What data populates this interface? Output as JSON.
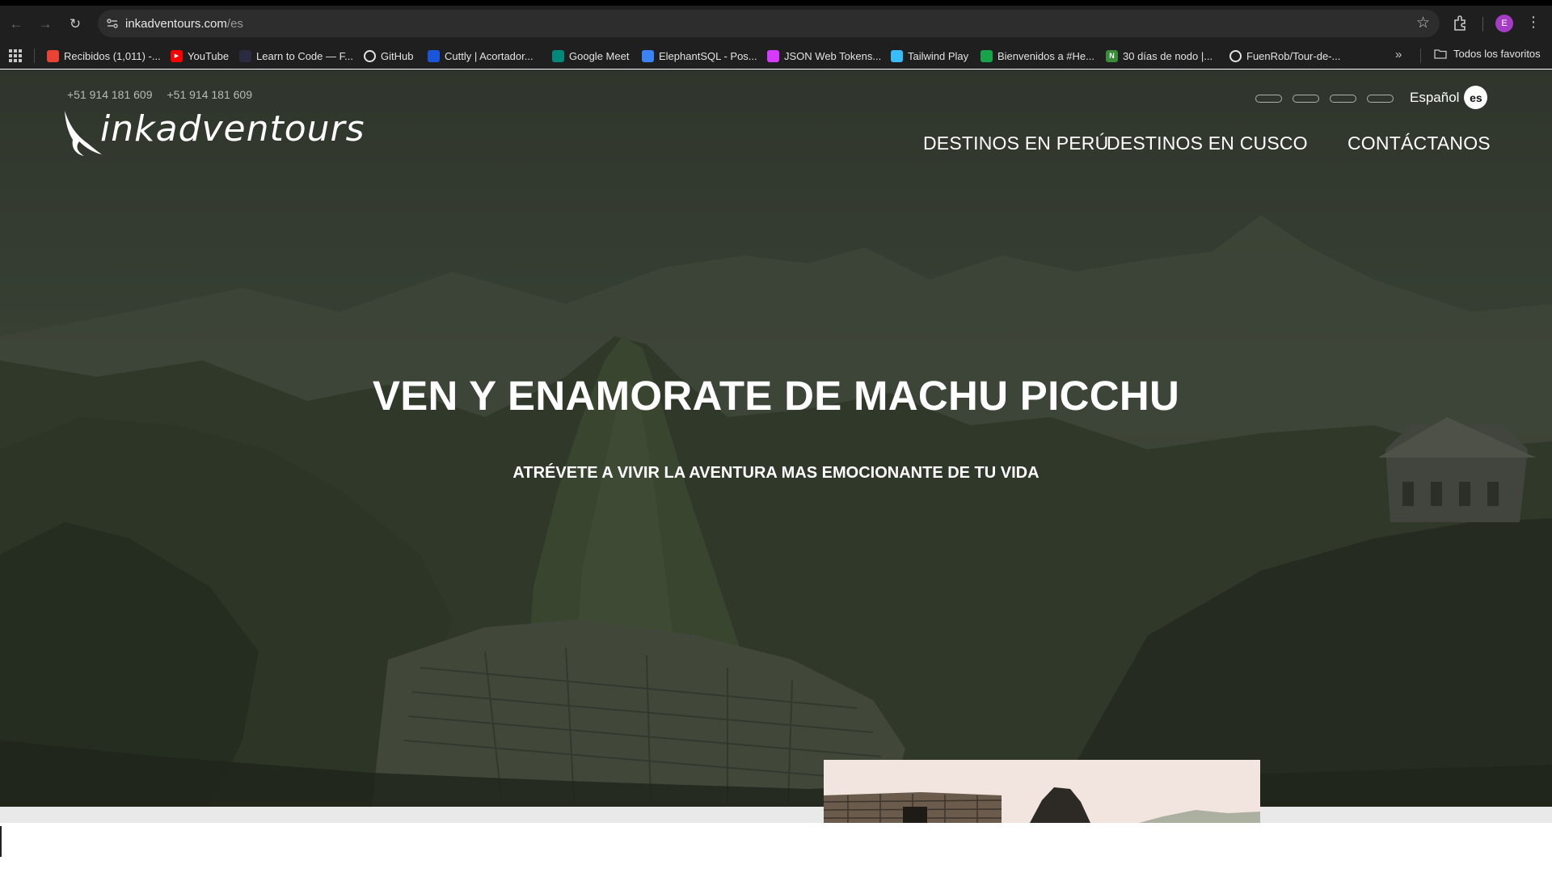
{
  "browser": {
    "url_host": "inkadventours.com",
    "url_path": "/es",
    "profile_initial": "E",
    "bookmarks": [
      {
        "label": "Recibidos (1,011) -...",
        "icon": "gmail-icon",
        "color": "#ea4335"
      },
      {
        "label": "YouTube",
        "icon": "youtube-icon",
        "color": "#ff0000"
      },
      {
        "label": "Learn to Code — F...",
        "icon": "freecodecamp-icon",
        "color": "#2a2a40"
      },
      {
        "label": "GitHub",
        "icon": "github-icon",
        "color": "#e3e3e3"
      },
      {
        "label": "Cuttly | Acortador...",
        "icon": "cuttly-icon",
        "color": "#1a56db"
      },
      {
        "label": "Google Meet",
        "icon": "google-meet-icon",
        "color": "#00897b"
      },
      {
        "label": "ElephantSQL - Pos...",
        "icon": "elephantsql-icon",
        "color": "#3b82f6"
      },
      {
        "label": "JSON Web Tokens...",
        "icon": "jwt-icon",
        "color": "#d63aff"
      },
      {
        "label": "Tailwind Play",
        "icon": "tailwind-icon",
        "color": "#38bdf8"
      },
      {
        "label": "Bienvenidos a #He...",
        "icon": "hackerrank-icon",
        "color": "#16a34a"
      },
      {
        "label": "30 días de nodo |...",
        "icon": "notion-icon",
        "color": "#3a8b3a"
      },
      {
        "label": "FuenRob/Tour-de-...",
        "icon": "github-icon",
        "color": "#e3e3e3"
      }
    ],
    "all_bookmarks_label": "Todos los favoritos"
  },
  "site": {
    "phones": [
      "+51 914 181 609",
      "+51 914 181 609"
    ],
    "logo_text": "inkadventours",
    "language_label": "Español",
    "language_code": "es",
    "nav": [
      "DESTINOS EN PERÚ",
      "DESTINOS EN CUSCO",
      "CONTÁCTANOS"
    ],
    "hero_title": "VEN Y ENAMORATE DE MACHU PICCHU",
    "hero_subtitle": "ATRÉVETE A VIVIR LA AVENTURA MAS EMOCIONANTE DE TU VIDA"
  }
}
